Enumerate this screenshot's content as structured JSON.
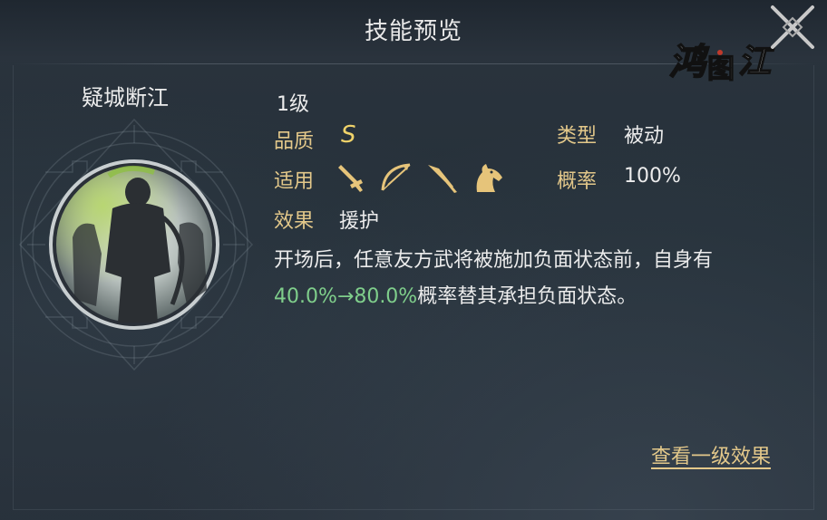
{
  "window": {
    "title": "技能预览"
  },
  "logo": {
    "text": "鸿图江"
  },
  "skill": {
    "name": "疑城断江",
    "level": "1级",
    "quality_label": "品质",
    "quality_value": "S",
    "type_label": "类型",
    "type_value": "被动",
    "applicable_label": "适用",
    "applicable_icons": [
      "sword-icon",
      "bow-icon",
      "spear-icon",
      "horse-icon"
    ],
    "rate_label": "概率",
    "rate_value": "100%",
    "effect_label": "效果",
    "effect_value": "援护",
    "description_line1": "开场后，任意友方武将被施加负面状态前，自身有",
    "description_highlight": "40.0%→80.0%",
    "description_line2_rest": "概率替其承担负面状态。"
  },
  "actions": {
    "view_level1": "查看一级效果"
  },
  "colors": {
    "background": "#273039",
    "label_gold": "#e3c88a",
    "quality_gold": "#f0d36a",
    "highlight_green": "#7fce8b",
    "text": "#ececec"
  }
}
